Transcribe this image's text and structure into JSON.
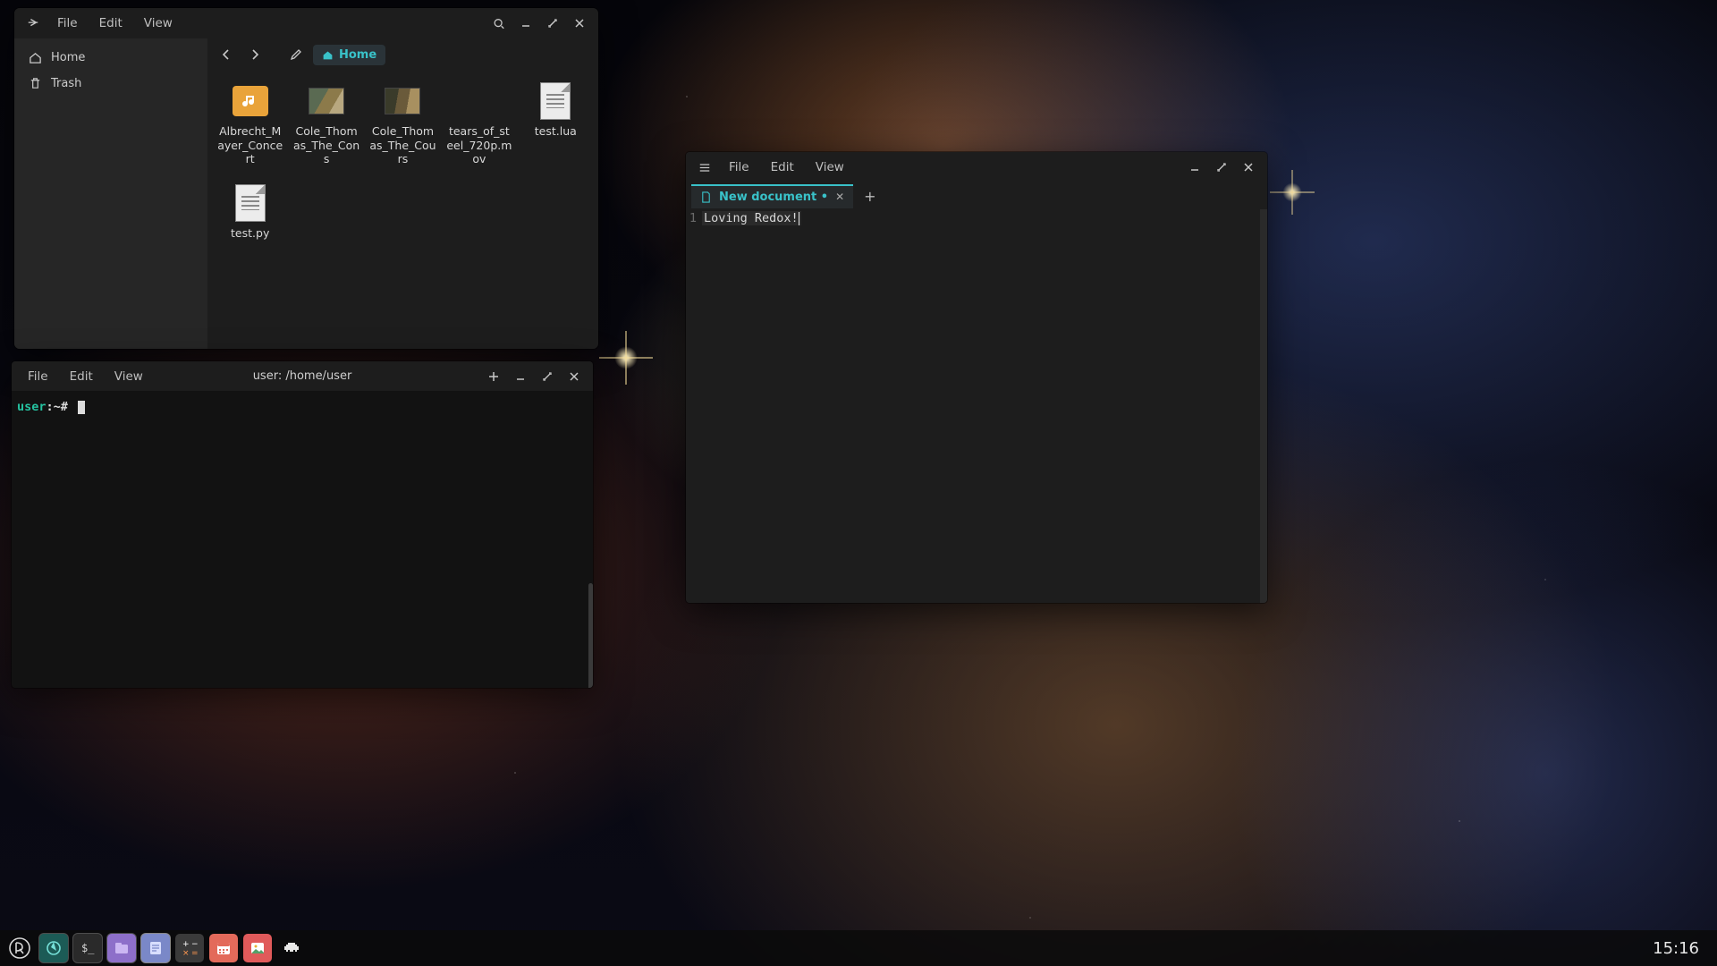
{
  "file_manager": {
    "menu": {
      "file": "File",
      "edit": "Edit",
      "view": "View"
    },
    "sidebar": {
      "home": "Home",
      "trash": "Trash"
    },
    "breadcrumb": "Home",
    "files": [
      {
        "name": "Albrecht_Mayer_Concert",
        "kind": "audio"
      },
      {
        "name": "Cole_Thomas_The_Cons",
        "kind": "image"
      },
      {
        "name": "Cole_Thomas_The_Cours",
        "kind": "image"
      },
      {
        "name": "tears_of_steel_720p.mov",
        "kind": "video"
      },
      {
        "name": "test.lua",
        "kind": "text"
      },
      {
        "name": "test.py",
        "kind": "text"
      }
    ]
  },
  "terminal": {
    "menu": {
      "file": "File",
      "edit": "Edit",
      "view": "View"
    },
    "title": "user: /home/user",
    "prompt_user": "user",
    "prompt_path": ":~#"
  },
  "editor": {
    "menu": {
      "file": "File",
      "edit": "Edit",
      "view": "View"
    },
    "tab_title": "New document •",
    "line_number": "1",
    "content": "Loving Redox!"
  },
  "taskbar": {
    "clock": "15:16"
  }
}
